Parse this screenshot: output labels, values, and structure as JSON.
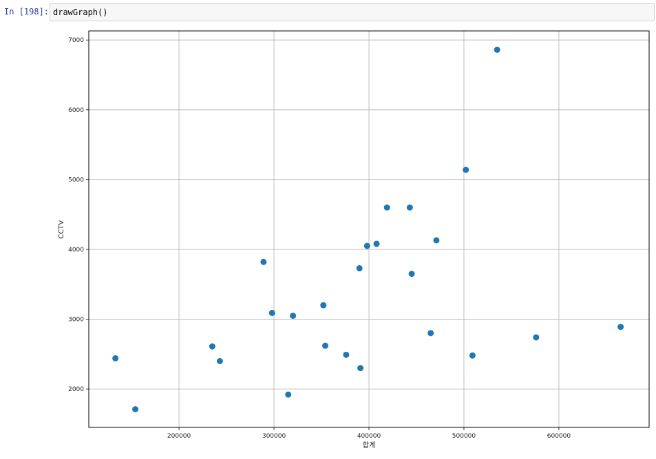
{
  "cell": {
    "prompt": "In [198]:",
    "code": "drawGraph()"
  },
  "chart_data": {
    "type": "scatter",
    "title": "",
    "xlabel": "합계",
    "ylabel": "CCTV",
    "xlim": [
      105000,
      695000
    ],
    "ylim": [
      1450,
      7130
    ],
    "x_ticks": [
      200000,
      300000,
      400000,
      500000,
      600000
    ],
    "y_ticks": [
      2000,
      3000,
      4000,
      5000,
      6000,
      7000
    ],
    "grid": true,
    "marker_color": "#1f77b4",
    "points": [
      {
        "x": 133000,
        "y": 2440
      },
      {
        "x": 154000,
        "y": 1710
      },
      {
        "x": 235000,
        "y": 2610
      },
      {
        "x": 243000,
        "y": 2400
      },
      {
        "x": 289000,
        "y": 3820
      },
      {
        "x": 298000,
        "y": 3090
      },
      {
        "x": 315000,
        "y": 1920
      },
      {
        "x": 320000,
        "y": 3050
      },
      {
        "x": 352000,
        "y": 3200
      },
      {
        "x": 354000,
        "y": 2620
      },
      {
        "x": 376000,
        "y": 2490
      },
      {
        "x": 390000,
        "y": 3730
      },
      {
        "x": 391000,
        "y": 2300
      },
      {
        "x": 398000,
        "y": 4050
      },
      {
        "x": 408000,
        "y": 4080
      },
      {
        "x": 419000,
        "y": 4600
      },
      {
        "x": 443000,
        "y": 4600
      },
      {
        "x": 445000,
        "y": 3650
      },
      {
        "x": 465000,
        "y": 2800
      },
      {
        "x": 471000,
        "y": 4130
      },
      {
        "x": 502000,
        "y": 5140
      },
      {
        "x": 509000,
        "y": 2480
      },
      {
        "x": 535000,
        "y": 6860
      },
      {
        "x": 576000,
        "y": 2740
      },
      {
        "x": 665000,
        "y": 2890
      }
    ]
  }
}
